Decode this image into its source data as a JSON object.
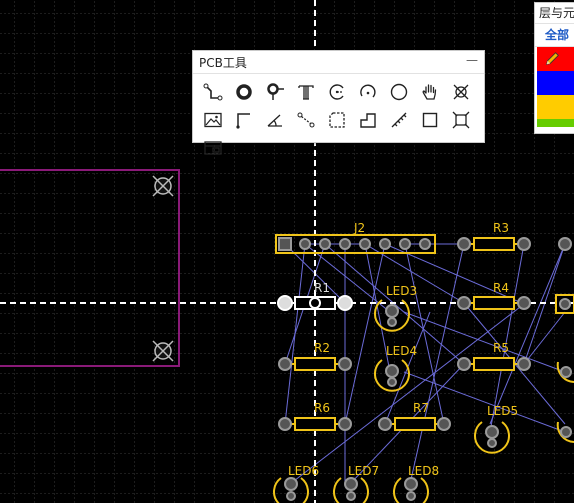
{
  "pcb_tools": {
    "title": "PCB工具",
    "minimize_glyph": "—",
    "tools": [
      {
        "name": "route-track-icon",
        "tooltip": "导线"
      },
      {
        "name": "via-icon",
        "tooltip": "过孔"
      },
      {
        "name": "pad-icon",
        "tooltip": "焊盘"
      },
      {
        "name": "text-icon",
        "tooltip": "文本"
      },
      {
        "name": "arc-center-icon",
        "tooltip": "圆弧"
      },
      {
        "name": "arc-3point-icon",
        "tooltip": "圆弧"
      },
      {
        "name": "circle-icon",
        "tooltip": "圆"
      },
      {
        "name": "pan-hand-icon",
        "tooltip": "平移"
      },
      {
        "name": "no-connect-icon",
        "tooltip": "禁止区域"
      },
      {
        "name": "image-icon",
        "tooltip": "图片"
      },
      {
        "name": "line-icon",
        "tooltip": "线"
      },
      {
        "name": "dimension-angle-icon",
        "tooltip": "尺寸"
      },
      {
        "name": "connect-pads-icon",
        "tooltip": "连接"
      },
      {
        "name": "copper-area-icon",
        "tooltip": "铺铜"
      },
      {
        "name": "solid-region-icon",
        "tooltip": "实心填充"
      },
      {
        "name": "measure-icon",
        "tooltip": "测量"
      },
      {
        "name": "rectangle-icon",
        "tooltip": "矩形"
      },
      {
        "name": "hole-icon",
        "tooltip": "孔"
      },
      {
        "name": "layer-panel-icon",
        "tooltip": "面板"
      }
    ]
  },
  "layers_panel": {
    "title": "层与元",
    "tab_all": "全部",
    "layers": [
      {
        "name": "top-layer",
        "color": "#ff0000",
        "active": true
      },
      {
        "name": "bottom-layer",
        "color": "#0000ff",
        "active": false
      },
      {
        "name": "top-silk-layer",
        "color": "#ffcc00",
        "active": false
      },
      {
        "name": "bottom-silk-layer",
        "color": "#66cc00",
        "active": false
      }
    ]
  },
  "board": {
    "components": [
      {
        "ref": "J2"
      },
      {
        "ref": "R3"
      },
      {
        "ref": "R1"
      },
      {
        "ref": "LED3"
      },
      {
        "ref": "R4"
      },
      {
        "ref": "R2"
      },
      {
        "ref": "LED4"
      },
      {
        "ref": "R5"
      },
      {
        "ref": "LED5"
      },
      {
        "ref": "R6"
      },
      {
        "ref": "R7"
      },
      {
        "ref": "LED6"
      },
      {
        "ref": "LED7"
      },
      {
        "ref": "LED8"
      }
    ],
    "colors": {
      "background": "#000000",
      "grid": "#3a3a3a",
      "silkscreen": "#f0c419",
      "ratsnest": "#6b6bd8",
      "board_outline": "#8a1a78",
      "pad": "#9a9a9a",
      "selected": "#ffffff"
    }
  }
}
